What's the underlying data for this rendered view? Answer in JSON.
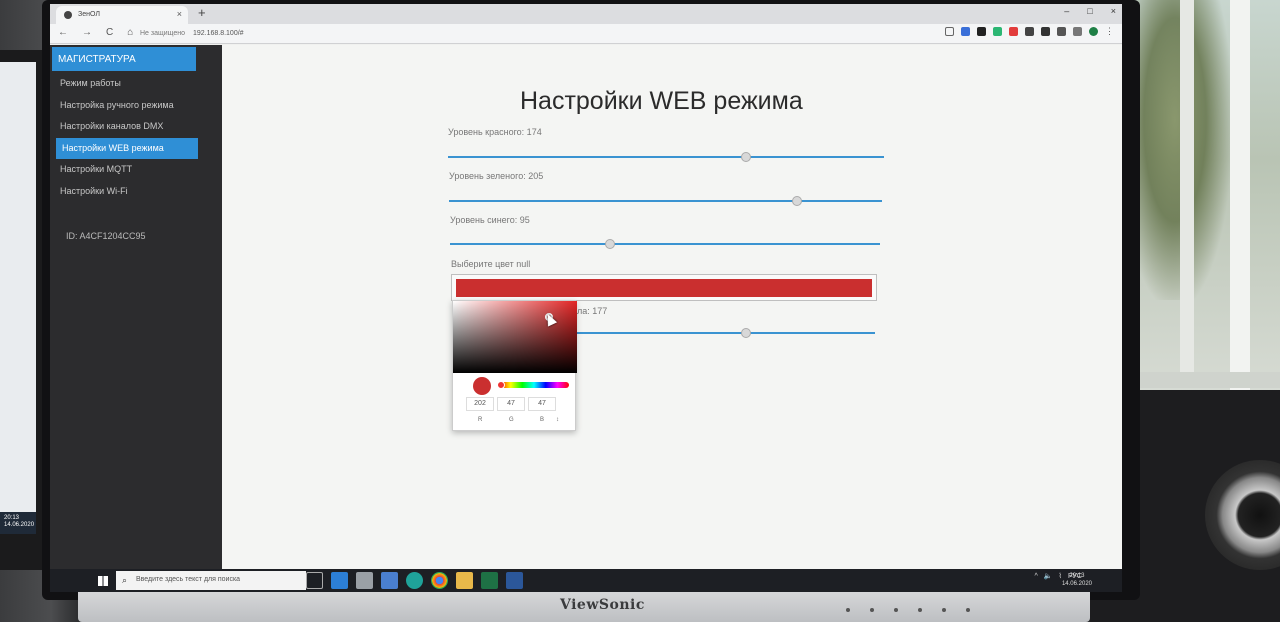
{
  "browser": {
    "tab_title": "ЗенОЛ",
    "tab_close": "×",
    "new_tab": "+",
    "window_controls": [
      "–",
      "□",
      "×"
    ],
    "nav": [
      "←",
      "→",
      "C",
      "⌂"
    ],
    "security_label": "Не защищено",
    "url": "192.168.8.100/#"
  },
  "sidebar": {
    "brand": "МАГИСТРАТУРА",
    "items": [
      {
        "label": "Режим работы"
      },
      {
        "label": "Настройка ручного режима"
      },
      {
        "label": "Настройки каналов DMX"
      },
      {
        "label": "Настройки WEB режима"
      },
      {
        "label": "Настройки MQTT"
      },
      {
        "label": "Настройки Wi-Fi"
      }
    ],
    "device_id": "ID: A4CF1204CC95"
  },
  "main": {
    "title": "Настройки WEB режима",
    "sliders": [
      {
        "label": "Уровень красного: 174",
        "value": 174,
        "max": 255
      },
      {
        "label": "Уровень зеленого: 205",
        "value": 205,
        "max": 255
      },
      {
        "label": "Уровень синего: 95",
        "value": 95,
        "max": 255
      },
      {
        "label": "анала: 177",
        "value": 177,
        "max": 255
      }
    ],
    "color_label": "Выберите цвет null",
    "color_value": "#ca2f2f",
    "picker": {
      "r": "202",
      "g": "47",
      "b": "47",
      "r_label": "R",
      "g_label": "G",
      "b_label": "B",
      "toggle": "↕"
    }
  },
  "taskbar": {
    "search_placeholder": "Введите здесь текст для поиска",
    "lang": "РУС",
    "time": "20:13",
    "date": "14.06.2020"
  },
  "monitor": {
    "brand": "ViewSonic"
  },
  "left_monitor": {
    "time": "20:13",
    "date": "14.06.2020"
  }
}
